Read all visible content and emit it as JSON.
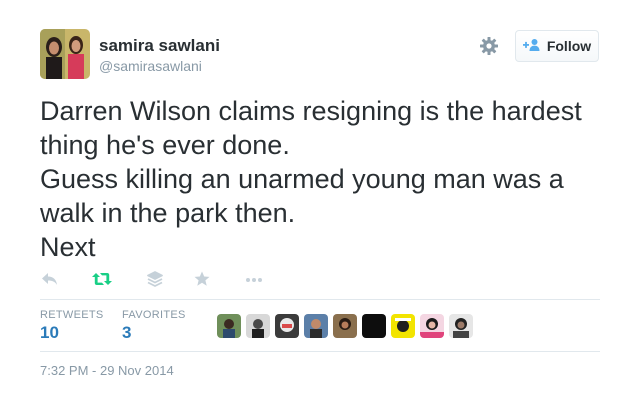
{
  "user": {
    "display_name": "samira sawlani",
    "handle": "@samirasawlani"
  },
  "follow_button": {
    "label": "Follow",
    "icon": "add-user-icon"
  },
  "settings": {
    "icon": "gear-icon"
  },
  "tweet": {
    "lines": [
      "Darren Wilson claims resigning is the hardest",
      "thing he's ever done.",
      "Guess killing an unarmed young man was a",
      "walk in the park then.",
      "Next"
    ]
  },
  "actions": [
    {
      "name": "reply-icon"
    },
    {
      "name": "retweet-icon"
    },
    {
      "name": "buffer-icon"
    },
    {
      "name": "favorite-icon"
    },
    {
      "name": "more-icon"
    }
  ],
  "stats": {
    "retweets_label": "RETWEETS",
    "retweets_count": "10",
    "favorites_label": "FAVORITES",
    "favorites_count": "3"
  },
  "timestamp": "7:32 PM - 29 Nov 2014",
  "colors": {
    "link_blue": "#2b7bb9",
    "retweet_green": "#19cf86",
    "muted": "#8899a6",
    "text": "#292f33"
  }
}
